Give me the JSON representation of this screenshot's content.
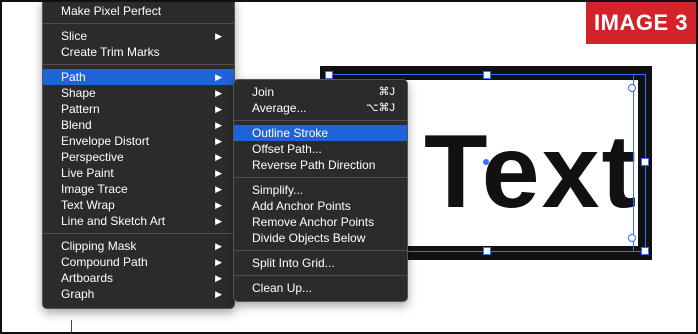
{
  "badge": {
    "label": "IMAGE 3",
    "color": "#d2232a"
  },
  "artboard": {
    "sample_text": "Text"
  },
  "main_menu": {
    "top_cut_label": "Make Pixel Perfect",
    "group1": [
      {
        "label": "Slice",
        "has_submenu": true
      },
      {
        "label": "Create Trim Marks",
        "has_submenu": false
      }
    ],
    "group2": [
      {
        "label": "Path",
        "has_submenu": true,
        "highlighted": true
      },
      {
        "label": "Shape",
        "has_submenu": true
      },
      {
        "label": "Pattern",
        "has_submenu": true
      },
      {
        "label": "Blend",
        "has_submenu": true
      },
      {
        "label": "Envelope Distort",
        "has_submenu": true
      },
      {
        "label": "Perspective",
        "has_submenu": true
      },
      {
        "label": "Live Paint",
        "has_submenu": true
      },
      {
        "label": "Image Trace",
        "has_submenu": true
      },
      {
        "label": "Text Wrap",
        "has_submenu": true
      },
      {
        "label": "Line and Sketch Art",
        "has_submenu": true
      }
    ],
    "group3": [
      {
        "label": "Clipping Mask",
        "has_submenu": true
      },
      {
        "label": "Compound Path",
        "has_submenu": true
      },
      {
        "label": "Artboards",
        "has_submenu": true
      },
      {
        "label": "Graph",
        "has_submenu": true
      }
    ]
  },
  "path_submenu": {
    "group1": [
      {
        "label": "Join",
        "shortcut": "⌘J"
      },
      {
        "label": "Average...",
        "shortcut": "⌥⌘J"
      }
    ],
    "group2": [
      {
        "label": "Outline Stroke",
        "highlighted": true
      },
      {
        "label": "Offset Path..."
      },
      {
        "label": "Reverse Path Direction"
      }
    ],
    "group3": [
      {
        "label": "Simplify..."
      },
      {
        "label": "Add Anchor Points"
      },
      {
        "label": "Remove Anchor Points"
      },
      {
        "label": "Divide Objects Below"
      }
    ],
    "group4": [
      {
        "label": "Split Into Grid..."
      }
    ],
    "group5": [
      {
        "label": "Clean Up..."
      }
    ]
  },
  "arrow_glyph": "▶",
  "colors": {
    "menu_bg": "#2b2b2e",
    "highlight": "#1e63d7",
    "selection": "#3d6bff"
  }
}
